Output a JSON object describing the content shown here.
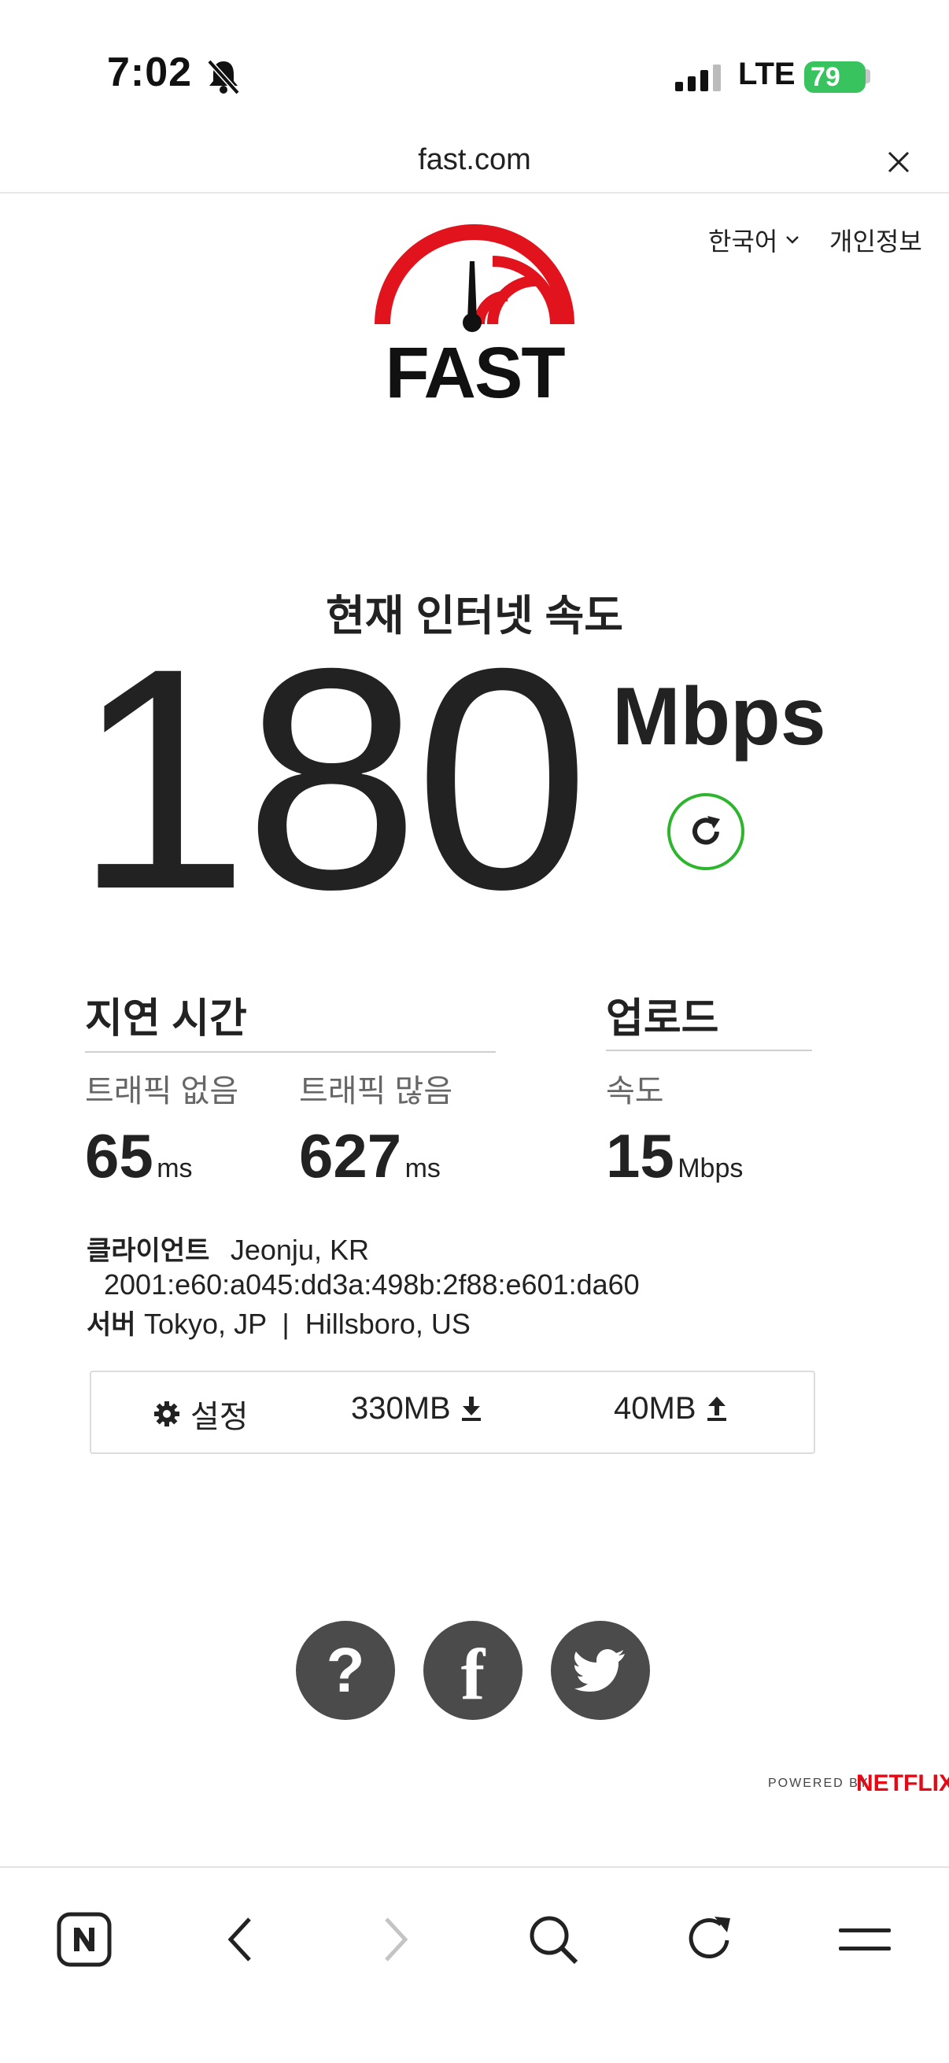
{
  "status_bar": {
    "time": "7:02",
    "network": "LTE",
    "battery": "79"
  },
  "browser": {
    "url": "fast.com"
  },
  "header": {
    "language": "한국어",
    "privacy": "개인정보",
    "logo_text": "FAST"
  },
  "speed": {
    "heading": "현재 인터넷 속도",
    "value": "180",
    "unit": "Mbps"
  },
  "latency": {
    "title": "지연 시간",
    "unloaded_label": "트래픽 없음",
    "unloaded_value": "65",
    "unloaded_unit": "ms",
    "loaded_label": "트래픽 많음",
    "loaded_value": "627",
    "loaded_unit": "ms"
  },
  "upload": {
    "title": "업로드",
    "label": "속도",
    "value": "15",
    "unit": "Mbps"
  },
  "client": {
    "label": "클라이언트",
    "location": "Jeonju, KR",
    "ip": "2001:e60:a045:dd3a:498b:2f88:e601:da60",
    "server_label": "서버",
    "servers": "Tokyo, JP  |  Hillsboro, US"
  },
  "settings_bar": {
    "settings_label": "설정",
    "download_size": "330MB",
    "upload_size": "40MB"
  },
  "footer": {
    "powered_by": "POWERED BY",
    "brand": "NETFLIX"
  },
  "colors": {
    "accent_red": "#e1141e",
    "refresh_green": "#2db52d",
    "netflix_red": "#e50914",
    "battery_green": "#39c35f"
  },
  "icons": [
    "bell-slash-icon",
    "signal-icon",
    "close-icon",
    "chevron-down-icon",
    "refresh-icon",
    "gear-icon",
    "download-icon",
    "upload-icon",
    "help-icon",
    "facebook-icon",
    "twitter-icon",
    "naver-icon",
    "back-icon",
    "forward-icon",
    "search-icon",
    "reload-icon",
    "menu-icon"
  ]
}
